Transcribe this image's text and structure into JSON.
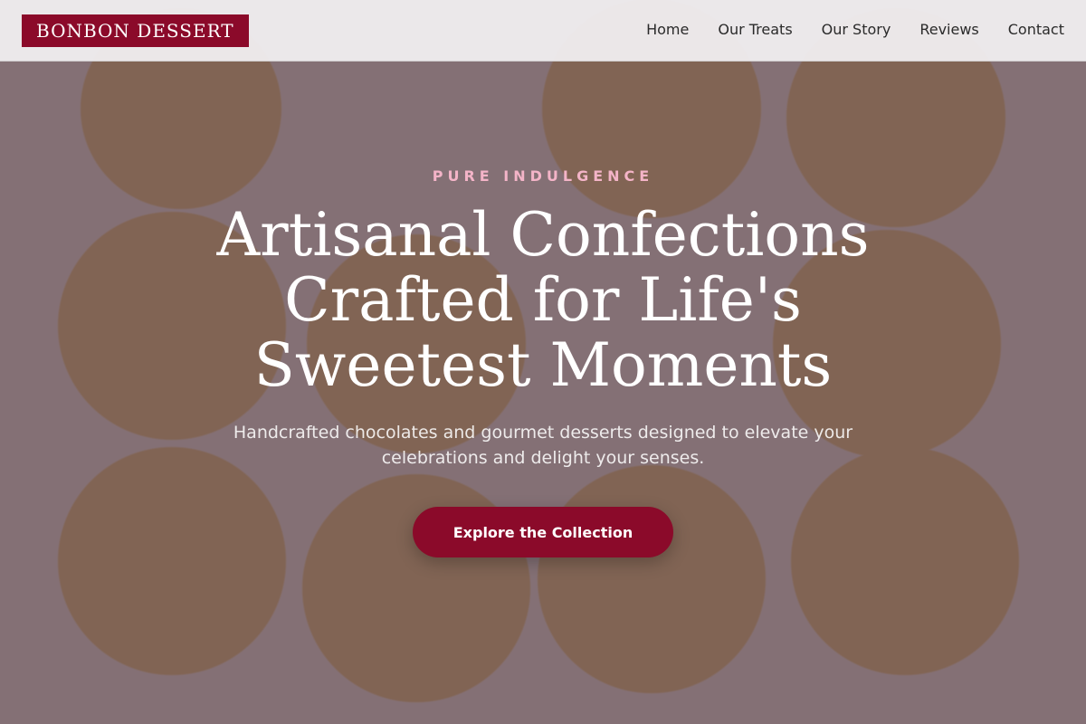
{
  "header": {
    "brand": "BONBON DESSERT",
    "nav": [
      {
        "label": "Home"
      },
      {
        "label": "Our Treats"
      },
      {
        "label": "Our Story"
      },
      {
        "label": "Reviews"
      },
      {
        "label": "Contact"
      }
    ]
  },
  "hero": {
    "eyebrow": "PURE INDULGENCE",
    "title": "Artisanal Confections Crafted for Life's Sweetest Moments",
    "subtitle": "Handcrafted chocolates and gourmet desserts designed to elevate your celebrations and delight your senses.",
    "cta_label": "Explore the Collection"
  },
  "colors": {
    "brand_bg": "#8b0a2a",
    "eyebrow": "#f4b4c8",
    "header_bg": "#f0eef0"
  }
}
